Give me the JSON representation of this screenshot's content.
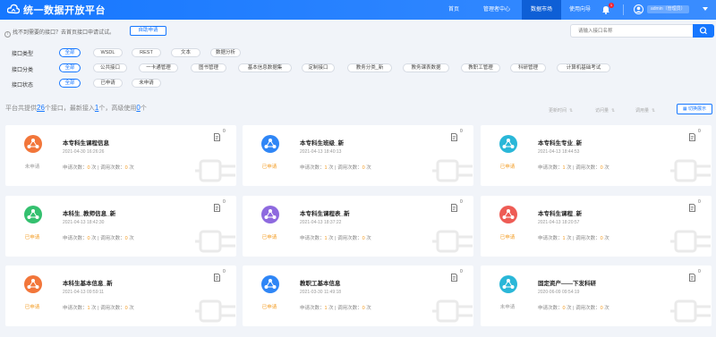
{
  "header": {
    "brand": "统一数据开放平台",
    "nav": [
      "首页",
      "管理者中心",
      "数据市场",
      "使用向导"
    ],
    "active_nav": 2,
    "notify_count": "1",
    "user": "admin（管理员）"
  },
  "hint": {
    "text": "找不到需要的接口？去首页接口申请试试。",
    "auto_apply": "自助申请"
  },
  "search": {
    "placeholder": "请输入接口名称"
  },
  "filters": {
    "type": {
      "label": "接口类型",
      "options": [
        "全部",
        "WSDL",
        "REST",
        "文本",
        "数据分析"
      ]
    },
    "category": {
      "label": "接口分类",
      "options": [
        "全部",
        "公共接口",
        "一卡通管理",
        "图书管理",
        "基本信息数据集",
        "定制接口",
        "教务分类_新",
        "教务课表数据",
        "教职工管理",
        "科研管理",
        "计算机基础考试"
      ]
    },
    "status": {
      "label": "接口状态",
      "options": [
        "全部",
        "已申请",
        "未申请"
      ]
    }
  },
  "stats": {
    "prefix": "平台共提供",
    "total": "26",
    "mid1": "个接口，最新接入",
    "newest": "1",
    "mid2": "个，高级使用",
    "advanced": "0",
    "suffix": "个"
  },
  "sort": {
    "update": "更新时间",
    "access": "访问量",
    "usage": "调用量"
  },
  "view_toggle": "切换展示",
  "labels": {
    "applications": "申请次数：",
    "applications_unit": "次",
    "calls": "调用次数：",
    "calls_unit": "次"
  },
  "colors": {
    "primary": "#1677ff",
    "orange": "#f39a1f",
    "gray": "#999999"
  },
  "cards": [
    {
      "title": "本专科生课程信息",
      "date": "2021-04-30 16:26:26",
      "status": "未申请",
      "apply": "0",
      "calls": "0",
      "count": "0",
      "color": "#f2763a"
    },
    {
      "title": "本专科生班级_新",
      "date": "2021-04-13 18:40:13",
      "status": "已申请",
      "apply": "1",
      "calls": "0",
      "count": "0",
      "color": "#2f86f6"
    },
    {
      "title": "本专科生专业_新",
      "date": "2021-04-13 18:44:53",
      "status": "已申请",
      "apply": "1",
      "calls": "0",
      "count": "0",
      "color": "#2ab7d8"
    },
    {
      "title": "本科生_教师信息_新",
      "date": "2021-04-13 18:42:30",
      "status": "已申请",
      "apply": "0",
      "calls": "0",
      "count": "0",
      "color": "#34c06f"
    },
    {
      "title": "本专科生课程表_新",
      "date": "2021-04-13 18:37:22",
      "status": "已申请",
      "apply": "1",
      "calls": "0",
      "count": "0",
      "color": "#8e6adf"
    },
    {
      "title": "本专科生课程_新",
      "date": "2021-04-13 18:20:57",
      "status": "已申请",
      "apply": "1",
      "calls": "0",
      "count": "0",
      "color": "#ee5c55"
    },
    {
      "title": "本科生基本信息_新",
      "date": "2021-04-13 09:59:11",
      "status": "已申请",
      "apply": "1",
      "calls": "0",
      "count": "0",
      "color": "#f2763a"
    },
    {
      "title": "教职工基本信息",
      "date": "2021-03-30 11:49:18",
      "status": "已申请",
      "apply": "1",
      "calls": "0",
      "count": "0",
      "color": "#2f86f6"
    },
    {
      "title": "固定资产——下发科研",
      "date": "2020-06-09 09:54:19",
      "status": "未申请",
      "apply": "0",
      "calls": "0",
      "count": "0",
      "color": "#2ab7d8"
    }
  ]
}
